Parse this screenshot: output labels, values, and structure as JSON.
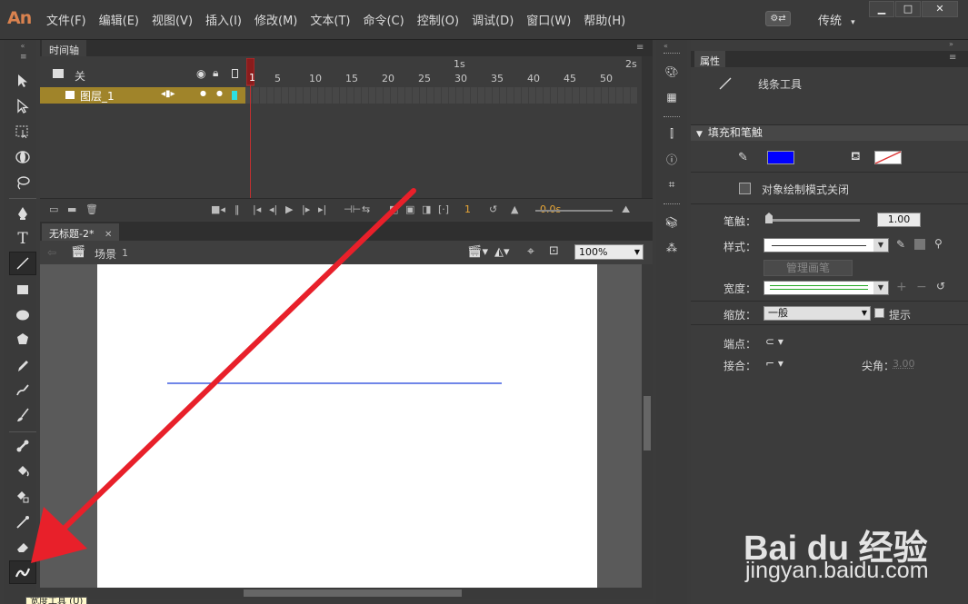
{
  "app": {
    "logo": "An"
  },
  "menu": [
    "文件(F)",
    "编辑(E)",
    "视图(V)",
    "插入(I)",
    "修改(M)",
    "文本(T)",
    "命令(C)",
    "控制(O)",
    "调试(D)",
    "窗口(W)",
    "帮助(H)"
  ],
  "workspace": {
    "label": "传统",
    "arrow": "▾"
  },
  "window_controls": {
    "minimize": "▁",
    "maximize": "□",
    "close": "✕"
  },
  "timeline": {
    "tab": "时间轴",
    "layer_folder_label": "关",
    "layer_name": "图层_1",
    "ruler_numbers": [
      "1",
      "5",
      "10",
      "15",
      "20",
      "25",
      "30",
      "35",
      "40",
      "45",
      "50"
    ],
    "ruler_seconds": [
      "1s",
      "2s"
    ],
    "current_frame": "1",
    "fps": "0.0s"
  },
  "document": {
    "tab": "无标题-2*",
    "tab_close": "✕",
    "scene_label": "场景",
    "scene_number": "1",
    "zoom": "100%"
  },
  "properties": {
    "tab": "属性",
    "tool_name": "线条工具",
    "fill_stroke_header": "填充和笔触",
    "object_draw_label": "对象绘制模式关闭",
    "stroke_label": "笔触：",
    "stroke_value": "1.00",
    "style_label": "样式：",
    "manage_brush": "管理画笔",
    "width_label": "宽度：",
    "scale_label": "缩放：",
    "scale_value": "一般",
    "hint_label": "提示",
    "cap_label": "端点：",
    "join_label": "接合：",
    "miter_label": "尖角：",
    "miter_value": "3.00"
  },
  "colors": {
    "stroke_color": "#0000ff",
    "line_on_stage": "#1a3fd9",
    "arrow": "#e8202a"
  },
  "tooltip": "宽度工具 (U)",
  "watermark": {
    "brand": "Bai du 经验",
    "url": "jingyan.baidu.com"
  }
}
